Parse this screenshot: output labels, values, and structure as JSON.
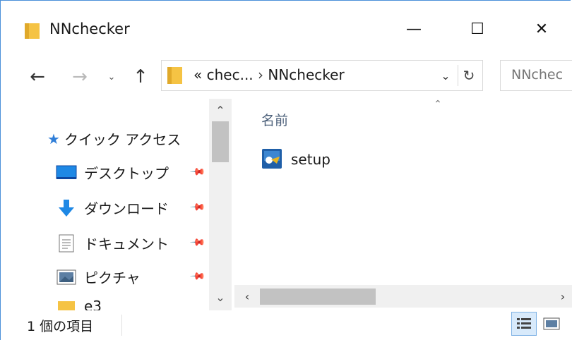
{
  "window": {
    "title": "NNchecker",
    "minimize_glyph": "—",
    "maximize_glyph": "☐",
    "close_glyph": "✕"
  },
  "nav": {
    "back_glyph": "←",
    "forward_glyph": "→",
    "recent_glyph": "⌄",
    "up_glyph": "↑"
  },
  "address": {
    "overflow": "«",
    "crumb_parent": "chec...",
    "separator": "›",
    "crumb_current": "NNchecker",
    "dropdown_glyph": "⌄",
    "refresh_glyph": "↻"
  },
  "search": {
    "placeholder": "NNchec"
  },
  "navpane": {
    "quick_access": "クイック アクセス",
    "items": [
      {
        "label": "デスクトップ",
        "icon": "desktop-icon"
      },
      {
        "label": "ダウンロード",
        "icon": "download-icon"
      },
      {
        "label": "ドキュメント",
        "icon": "documents-icon"
      },
      {
        "label": "ピクチャ",
        "icon": "pictures-icon"
      },
      {
        "label": "e3",
        "icon": "folder-icon"
      }
    ],
    "scroll_up": "⌃",
    "scroll_down": "⌄"
  },
  "content": {
    "column_name": "名前",
    "sort_glyph": "⌃",
    "files": [
      {
        "name": "setup",
        "icon": "setup-installer-icon"
      }
    ],
    "hscroll_left": "‹",
    "hscroll_right": "›"
  },
  "status": {
    "item_count": "1 個の項目"
  },
  "colors": {
    "accent": "#4a90d9",
    "folder": "#f5c344",
    "selected_view": "#d8eafb"
  }
}
